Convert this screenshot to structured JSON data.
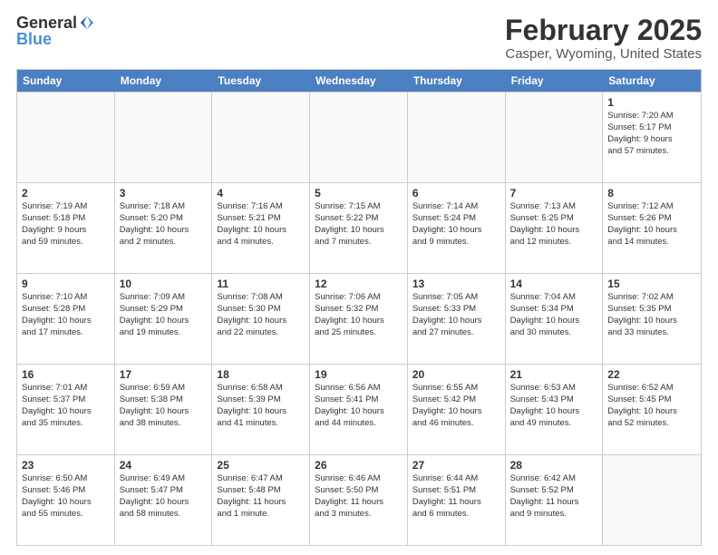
{
  "header": {
    "logo_general": "General",
    "logo_blue": "Blue",
    "title": "February 2025",
    "subtitle": "Casper, Wyoming, United States"
  },
  "calendar": {
    "days_of_week": [
      "Sunday",
      "Monday",
      "Tuesday",
      "Wednesday",
      "Thursday",
      "Friday",
      "Saturday"
    ],
    "weeks": [
      [
        {
          "day": "",
          "empty": true
        },
        {
          "day": "",
          "empty": true
        },
        {
          "day": "",
          "empty": true
        },
        {
          "day": "",
          "empty": true
        },
        {
          "day": "",
          "empty": true
        },
        {
          "day": "",
          "empty": true
        },
        {
          "day": "1",
          "lines": [
            "Sunrise: 7:20 AM",
            "Sunset: 5:17 PM",
            "Daylight: 9 hours",
            "and 57 minutes."
          ]
        }
      ],
      [
        {
          "day": "2",
          "lines": [
            "Sunrise: 7:19 AM",
            "Sunset: 5:18 PM",
            "Daylight: 9 hours",
            "and 59 minutes."
          ]
        },
        {
          "day": "3",
          "lines": [
            "Sunrise: 7:18 AM",
            "Sunset: 5:20 PM",
            "Daylight: 10 hours",
            "and 2 minutes."
          ]
        },
        {
          "day": "4",
          "lines": [
            "Sunrise: 7:16 AM",
            "Sunset: 5:21 PM",
            "Daylight: 10 hours",
            "and 4 minutes."
          ]
        },
        {
          "day": "5",
          "lines": [
            "Sunrise: 7:15 AM",
            "Sunset: 5:22 PM",
            "Daylight: 10 hours",
            "and 7 minutes."
          ]
        },
        {
          "day": "6",
          "lines": [
            "Sunrise: 7:14 AM",
            "Sunset: 5:24 PM",
            "Daylight: 10 hours",
            "and 9 minutes."
          ]
        },
        {
          "day": "7",
          "lines": [
            "Sunrise: 7:13 AM",
            "Sunset: 5:25 PM",
            "Daylight: 10 hours",
            "and 12 minutes."
          ]
        },
        {
          "day": "8",
          "lines": [
            "Sunrise: 7:12 AM",
            "Sunset: 5:26 PM",
            "Daylight: 10 hours",
            "and 14 minutes."
          ]
        }
      ],
      [
        {
          "day": "9",
          "lines": [
            "Sunrise: 7:10 AM",
            "Sunset: 5:28 PM",
            "Daylight: 10 hours",
            "and 17 minutes."
          ]
        },
        {
          "day": "10",
          "lines": [
            "Sunrise: 7:09 AM",
            "Sunset: 5:29 PM",
            "Daylight: 10 hours",
            "and 19 minutes."
          ]
        },
        {
          "day": "11",
          "lines": [
            "Sunrise: 7:08 AM",
            "Sunset: 5:30 PM",
            "Daylight: 10 hours",
            "and 22 minutes."
          ]
        },
        {
          "day": "12",
          "lines": [
            "Sunrise: 7:06 AM",
            "Sunset: 5:32 PM",
            "Daylight: 10 hours",
            "and 25 minutes."
          ]
        },
        {
          "day": "13",
          "lines": [
            "Sunrise: 7:05 AM",
            "Sunset: 5:33 PM",
            "Daylight: 10 hours",
            "and 27 minutes."
          ]
        },
        {
          "day": "14",
          "lines": [
            "Sunrise: 7:04 AM",
            "Sunset: 5:34 PM",
            "Daylight: 10 hours",
            "and 30 minutes."
          ]
        },
        {
          "day": "15",
          "lines": [
            "Sunrise: 7:02 AM",
            "Sunset: 5:35 PM",
            "Daylight: 10 hours",
            "and 33 minutes."
          ]
        }
      ],
      [
        {
          "day": "16",
          "lines": [
            "Sunrise: 7:01 AM",
            "Sunset: 5:37 PM",
            "Daylight: 10 hours",
            "and 35 minutes."
          ]
        },
        {
          "day": "17",
          "lines": [
            "Sunrise: 6:59 AM",
            "Sunset: 5:38 PM",
            "Daylight: 10 hours",
            "and 38 minutes."
          ]
        },
        {
          "day": "18",
          "lines": [
            "Sunrise: 6:58 AM",
            "Sunset: 5:39 PM",
            "Daylight: 10 hours",
            "and 41 minutes."
          ]
        },
        {
          "day": "19",
          "lines": [
            "Sunrise: 6:56 AM",
            "Sunset: 5:41 PM",
            "Daylight: 10 hours",
            "and 44 minutes."
          ]
        },
        {
          "day": "20",
          "lines": [
            "Sunrise: 6:55 AM",
            "Sunset: 5:42 PM",
            "Daylight: 10 hours",
            "and 46 minutes."
          ]
        },
        {
          "day": "21",
          "lines": [
            "Sunrise: 6:53 AM",
            "Sunset: 5:43 PM",
            "Daylight: 10 hours",
            "and 49 minutes."
          ]
        },
        {
          "day": "22",
          "lines": [
            "Sunrise: 6:52 AM",
            "Sunset: 5:45 PM",
            "Daylight: 10 hours",
            "and 52 minutes."
          ]
        }
      ],
      [
        {
          "day": "23",
          "lines": [
            "Sunrise: 6:50 AM",
            "Sunset: 5:46 PM",
            "Daylight: 10 hours",
            "and 55 minutes."
          ]
        },
        {
          "day": "24",
          "lines": [
            "Sunrise: 6:49 AM",
            "Sunset: 5:47 PM",
            "Daylight: 10 hours",
            "and 58 minutes."
          ]
        },
        {
          "day": "25",
          "lines": [
            "Sunrise: 6:47 AM",
            "Sunset: 5:48 PM",
            "Daylight: 11 hours",
            "and 1 minute."
          ]
        },
        {
          "day": "26",
          "lines": [
            "Sunrise: 6:46 AM",
            "Sunset: 5:50 PM",
            "Daylight: 11 hours",
            "and 3 minutes."
          ]
        },
        {
          "day": "27",
          "lines": [
            "Sunrise: 6:44 AM",
            "Sunset: 5:51 PM",
            "Daylight: 11 hours",
            "and 6 minutes."
          ]
        },
        {
          "day": "28",
          "lines": [
            "Sunrise: 6:42 AM",
            "Sunset: 5:52 PM",
            "Daylight: 11 hours",
            "and 9 minutes."
          ]
        },
        {
          "day": "",
          "empty": true
        }
      ]
    ]
  }
}
